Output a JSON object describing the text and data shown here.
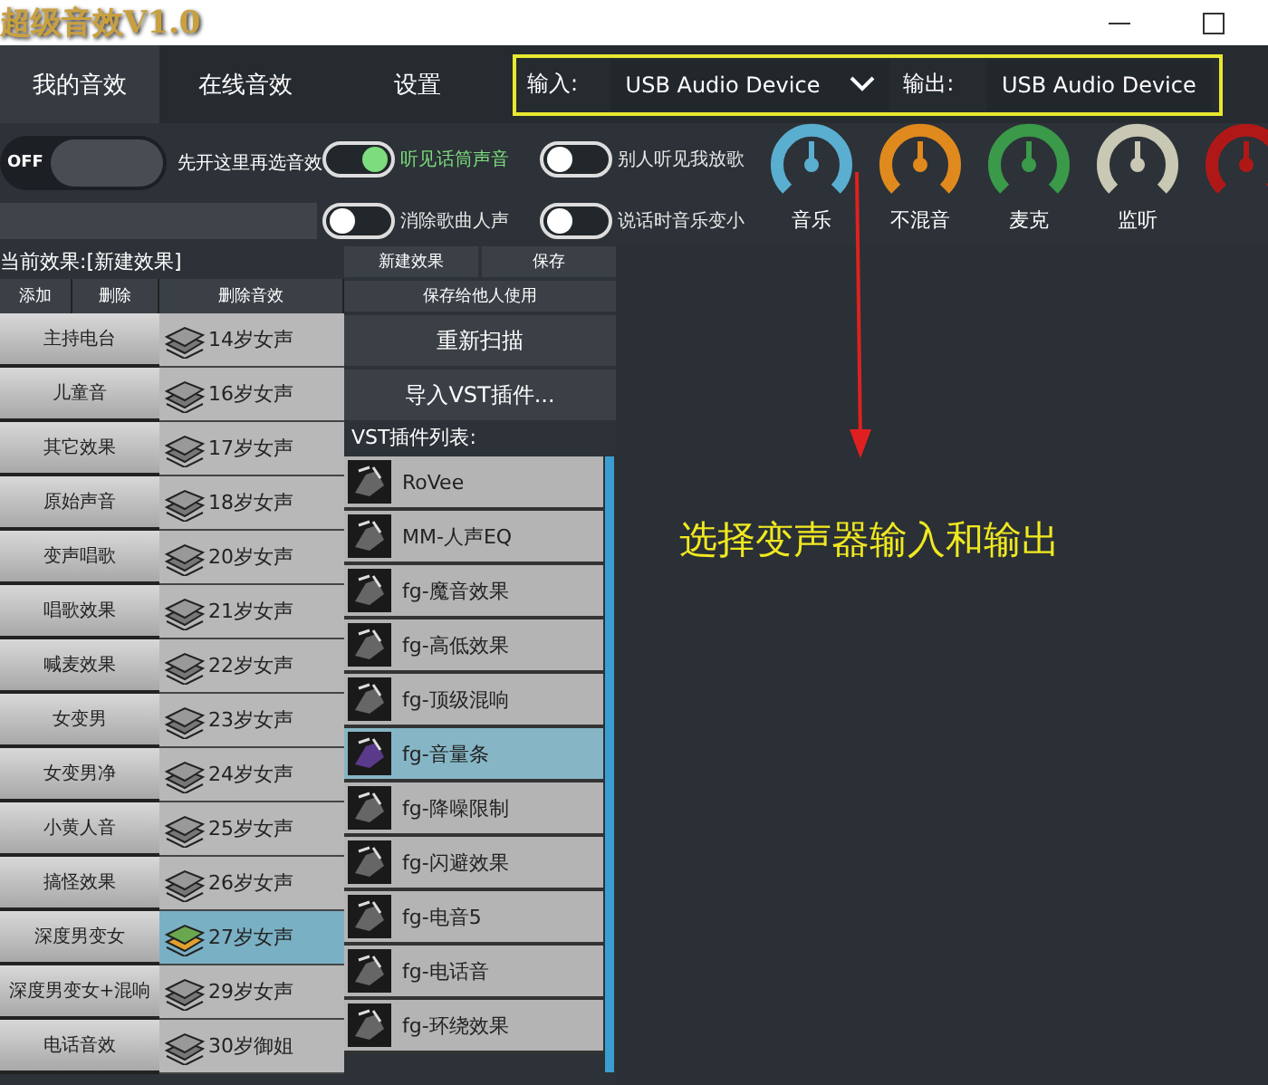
{
  "window": {
    "title": "超级音效V1.0"
  },
  "tabs": [
    {
      "label": "我的音效",
      "selected": true
    },
    {
      "label": "在线音效",
      "selected": false
    },
    {
      "label": "设置",
      "selected": false
    }
  ],
  "devices": {
    "input_label": "输入:",
    "input_value": "USB Audio Device",
    "output_label": "输出:",
    "output_value": "USB Audio Device"
  },
  "power": {
    "label": "OFF",
    "on": false,
    "hint": "先开这里再选音效"
  },
  "toggles": [
    {
      "label": "听见话筒声音",
      "on": true
    },
    {
      "label": "别人听见我放歌",
      "on": false
    },
    {
      "label": "消除歌曲人声",
      "on": false
    },
    {
      "label": "说话时音乐变小",
      "on": false
    }
  ],
  "knobs": [
    {
      "label": "音乐",
      "color": "#5aaed0"
    },
    {
      "label": "不混音",
      "color": "#e08a1e"
    },
    {
      "label": "麦克",
      "color": "#3a9a4a"
    },
    {
      "label": "监听",
      "color": "#c8c8b4"
    },
    {
      "color": "#b01818"
    }
  ],
  "current_effect": "当前效果:[新建效果]",
  "effect_buttons": [
    "添加",
    "删除",
    "删除音效"
  ],
  "preset_buttons": [
    "新建效果",
    "保存",
    "保存给他人使用",
    "重新扫描",
    "导入VST插件..."
  ],
  "categories": [
    "主持电台",
    "儿童音",
    "其它效果",
    "原始声音",
    "变声唱歌",
    "唱歌效果",
    "喊麦效果",
    "女变男",
    "女变男净",
    "小黄人音",
    "搞怪效果",
    "深度男变女",
    "深度男变女+混响",
    "电话音效"
  ],
  "presets": [
    {
      "label": "14岁女声",
      "selected": false
    },
    {
      "label": "16岁女声",
      "selected": false
    },
    {
      "label": "17岁女声",
      "selected": false
    },
    {
      "label": "18岁女声",
      "selected": false
    },
    {
      "label": "20岁女声",
      "selected": false
    },
    {
      "label": "21岁女声",
      "selected": false
    },
    {
      "label": "22岁女声",
      "selected": false
    },
    {
      "label": "23岁女声",
      "selected": false
    },
    {
      "label": "24岁女声",
      "selected": false
    },
    {
      "label": "25岁女声",
      "selected": false
    },
    {
      "label": "26岁女声",
      "selected": false
    },
    {
      "label": "27岁女声",
      "selected": true
    },
    {
      "label": "29岁女声",
      "selected": false
    },
    {
      "label": "30岁御姐",
      "selected": false
    }
  ],
  "vst_list_title": "VST插件列表:",
  "plugins": [
    {
      "label": "RoVee",
      "selected": false
    },
    {
      "label": "MM-人声EQ",
      "selected": false
    },
    {
      "label": "fg-魔音效果",
      "selected": false
    },
    {
      "label": "fg-高低效果",
      "selected": false
    },
    {
      "label": "fg-顶级混响",
      "selected": false
    },
    {
      "label": "fg-音量条",
      "selected": true
    },
    {
      "label": "fg-降噪限制",
      "selected": false
    },
    {
      "label": "fg-闪避效果",
      "selected": false
    },
    {
      "label": "fg-电音5",
      "selected": false
    },
    {
      "label": "fg-电话音",
      "selected": false
    },
    {
      "label": "fg-环绕效果",
      "selected": false
    }
  ],
  "annotation": "选择变声器输入和输出"
}
